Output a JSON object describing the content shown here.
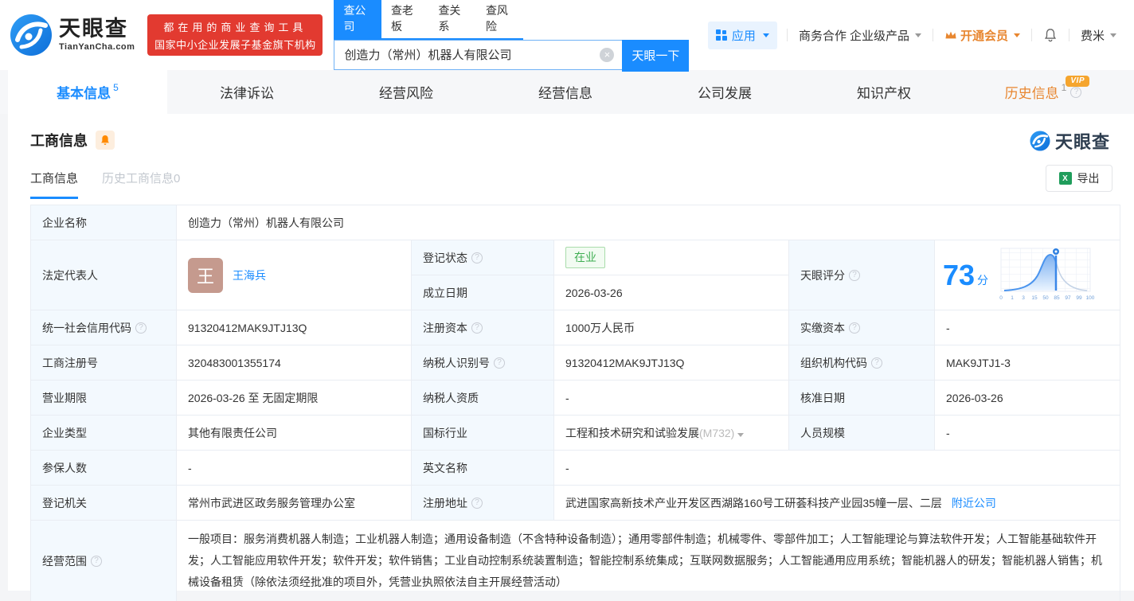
{
  "header": {
    "logo": {
      "name": "天眼查",
      "domain": "TianYanCha.com"
    },
    "slogan": {
      "line1": "都在用的商业查询工具",
      "line2": "国家中小企业发展子基金旗下机构"
    },
    "search": {
      "tabs": [
        {
          "label": "查公司"
        },
        {
          "label": "查老板"
        },
        {
          "label": "查关系"
        },
        {
          "label": "查风险"
        }
      ],
      "value": "创造力（常州）机器人有限公司",
      "button": "天眼一下"
    },
    "menu": {
      "apps": "应用",
      "cooperation": "商务合作",
      "enterprise": "企业级产品",
      "vip": "开通会员",
      "user": "费米"
    }
  },
  "nav": {
    "tabs": [
      {
        "label": "基本信息",
        "count": "5"
      },
      {
        "label": "法律诉讼"
      },
      {
        "label": "经营风险"
      },
      {
        "label": "经营信息"
      },
      {
        "label": "公司发展"
      },
      {
        "label": "知识产权"
      },
      {
        "label": "历史信息",
        "count": "1",
        "badge": "VIP"
      }
    ]
  },
  "section": {
    "title": "工商信息",
    "watermark": "天眼查",
    "subtabs": [
      {
        "label": "工商信息"
      },
      {
        "label": "历史工商信息0"
      }
    ],
    "export_label": "导出"
  },
  "table": {
    "company_name": {
      "label": "企业名称",
      "value": "创造力（常州）机器人有限公司"
    },
    "legal_rep": {
      "label": "法定代表人",
      "value": "王海兵",
      "avatar": "王"
    },
    "reg_status": {
      "label": "登记状态",
      "value": "在业"
    },
    "established": {
      "label": "成立日期",
      "value": "2026-03-26"
    },
    "score": {
      "label": "天眼评分",
      "value": "73",
      "unit": "分"
    },
    "credit_code": {
      "label": "统一社会信用代码",
      "value": "91320412MAK9JTJ13Q"
    },
    "reg_capital": {
      "label": "注册资本",
      "value": "1000万人民币"
    },
    "paid_capital": {
      "label": "实缴资本",
      "value": "-"
    },
    "reg_number": {
      "label": "工商注册号",
      "value": "320483001355174"
    },
    "taxpayer_id": {
      "label": "纳税人识别号",
      "value": "91320412MAK9JTJ13Q"
    },
    "org_code": {
      "label": "组织机构代码",
      "value": "MAK9JTJ1-3"
    },
    "business_term": {
      "label": "营业期限",
      "value": "2026-03-26 至 无固定期限"
    },
    "taxpayer_quality": {
      "label": "纳税人资质",
      "value": "-"
    },
    "approval_date": {
      "label": "核准日期",
      "value": "2026-03-26"
    },
    "company_type": {
      "label": "企业类型",
      "value": "其他有限责任公司"
    },
    "industry": {
      "label": "国标行业",
      "value": "工程和技术研究和试验发展",
      "code": "(M732)"
    },
    "staff_size": {
      "label": "人员规模",
      "value": "-"
    },
    "insured_count": {
      "label": "参保人数",
      "value": "-"
    },
    "english_name": {
      "label": "英文名称",
      "value": "-"
    },
    "reg_authority": {
      "label": "登记机关",
      "value": "常州市武进区政务服务管理办公室"
    },
    "reg_address": {
      "label": "注册地址",
      "value": "武进国家高新技术产业开发区西湖路160号工研荟科技产业园35幢一层、二层",
      "nearby": "附近公司"
    },
    "business_scope": {
      "label": "经营范围",
      "value": "一般项目：服务消费机器人制造；工业机器人制造；通用设备制造（不含特种设备制造）；通用零部件制造；机械零件、零部件加工；人工智能理论与算法软件开发；人工智能基础软件开发；人工智能应用软件开发；软件开发；软件销售；工业自动控制系统装置制造；智能控制系统集成；互联网数据服务；人工智能通用应用系统；智能机器人的研发；智能机器人销售；机械设备租赁（除依法须经批准的项目外，凭营业执照依法自主开展经营活动）"
    }
  },
  "score_chart": {
    "type": "area",
    "ticks": [
      "0",
      "1",
      "3",
      "15",
      "50",
      "85",
      "97",
      "99",
      "100"
    ],
    "marker_value": 73
  }
}
